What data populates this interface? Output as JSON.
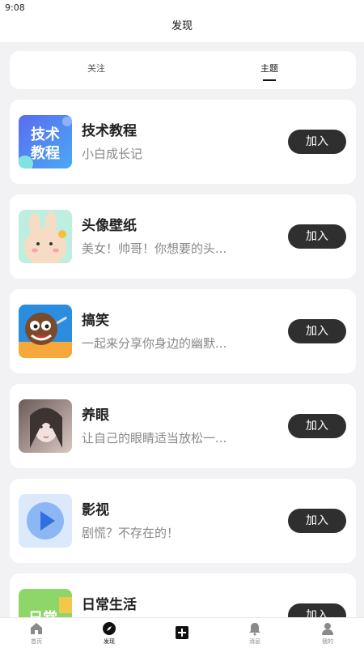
{
  "status_bar": {
    "time": "9:08"
  },
  "header": {
    "title": "发现"
  },
  "tabs": [
    {
      "label": "关注",
      "active": false
    },
    {
      "label": "主题",
      "active": true
    }
  ],
  "topics": [
    {
      "title": "技术教程",
      "subtitle": "小白成长记",
      "button": "加入",
      "thumb_text": [
        "技术",
        "教程"
      ],
      "thumb_colors": [
        "#5a6cf0",
        "#4aa8f5"
      ]
    },
    {
      "title": "头像壁纸",
      "subtitle": "美女！帅哥！你想要的头...",
      "button": "加入",
      "thumb_colors": [
        "#bdeee0",
        "#f7dcc5"
      ]
    },
    {
      "title": "搞笑",
      "subtitle": "一起来分享你身边的幽默...",
      "button": "加入",
      "thumb_colors": [
        "#2b8de0",
        "#f7a83a"
      ]
    },
    {
      "title": "养眼",
      "subtitle": "让自己的眼睛适当放松一...",
      "button": "加入",
      "thumb_colors": [
        "#6b5a56",
        "#d9c7c2"
      ]
    },
    {
      "title": "影视",
      "subtitle": "剧慌？不存在的！",
      "button": "加入",
      "thumb_colors": [
        "#dce9fb",
        "#3b82e8"
      ]
    },
    {
      "title": "日常生活",
      "subtitle": "",
      "button": "加入",
      "thumb_text": [
        "日常"
      ],
      "thumb_colors": [
        "#8fd66a",
        "#f2c84a"
      ]
    }
  ],
  "tabbar": [
    {
      "label": "首页",
      "icon": "home-icon"
    },
    {
      "label": "发现",
      "icon": "compass-icon",
      "active": true
    },
    {
      "label": "",
      "icon": "plus-square-icon"
    },
    {
      "label": "消息",
      "icon": "bell-icon"
    },
    {
      "label": "我的",
      "icon": "user-icon"
    }
  ]
}
